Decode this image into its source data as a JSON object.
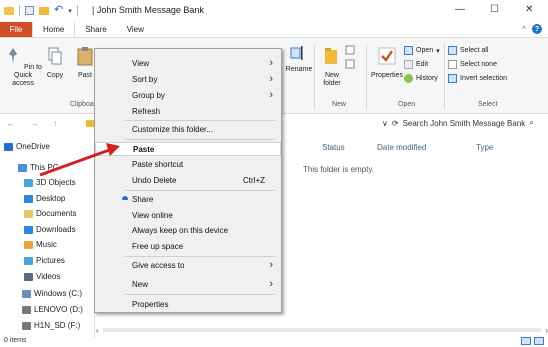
{
  "window": {
    "title": "John Smith Message Bank",
    "title_separator": "|",
    "minimize": "—",
    "maximize": "☐",
    "close": "✕"
  },
  "ribbon_tabs": {
    "file": "File",
    "home": "Home",
    "share": "Share",
    "view": "View"
  },
  "ribbon": {
    "pin_to_quick_access": "Pin to Quick access",
    "copy": "Copy",
    "paste_partial": "Past",
    "clipboard_group_partial": "Clipboa",
    "rename": "Rename",
    "new_folder": "New folder",
    "new_group": "New",
    "properties": "Properties",
    "open": "Open",
    "edit": "Edit",
    "history": "History",
    "open_group": "Open",
    "select_all": "Select all",
    "select_none": "Select none",
    "invert_selection": "Invert selection",
    "select_group": "Select"
  },
  "address_bar": {
    "nav": "← → ↑",
    "refresh": "⟳",
    "chevron": "∨",
    "search_placeholder": "Search John Smith Message Bank"
  },
  "nav_pane": {
    "items": [
      {
        "label": "OneDrive",
        "color": "#1e73c8"
      },
      {
        "label": "This PC",
        "color": "#4a90d9"
      },
      {
        "label": "3D Objects",
        "color": "#4aa3df"
      },
      {
        "label": "Desktop",
        "color": "#2e86de"
      },
      {
        "label": "Documents",
        "color": "#e8c468"
      },
      {
        "label": "Downloads",
        "color": "#2e86de"
      },
      {
        "label": "Music",
        "color": "#e8a33c"
      },
      {
        "label": "Pictures",
        "color": "#4aa3df"
      },
      {
        "label": "Videos",
        "color": "#5a6b7b"
      },
      {
        "label": "Windows (C:)",
        "color": "#6b8fbd"
      },
      {
        "label": "LENOVO (D:)",
        "color": "#777777"
      },
      {
        "label": "H1N_SD (F:)",
        "color": "#777777"
      }
    ]
  },
  "columns": {
    "status": "Status",
    "date_modified": "Date modified",
    "type": "Type"
  },
  "empty_message": "This folder is empty.",
  "status_bar": {
    "items": "0 items"
  },
  "context_menu": {
    "items": [
      {
        "label": "View",
        "submenu": true
      },
      {
        "label": "Sort by",
        "submenu": true
      },
      {
        "label": "Group by",
        "submenu": true
      },
      {
        "label": "Refresh"
      },
      {
        "label": "Customize this folder..."
      },
      {
        "label": "Paste",
        "highlighted": true
      },
      {
        "label": "Paste shortcut"
      },
      {
        "label": "Undo Delete",
        "shortcut": "Ctrl+Z"
      },
      {
        "label": "Share"
      },
      {
        "label": "View online"
      },
      {
        "label": "Always keep on this device"
      },
      {
        "label": "Free up space"
      },
      {
        "label": "Give access to",
        "submenu": true
      },
      {
        "label": "New",
        "submenu": true
      },
      {
        "label": "Properties"
      }
    ],
    "arrow_glyph": "›"
  },
  "colors": {
    "file_tab": "#d14f24",
    "accent": "#1e73c8",
    "annotation_arrow": "#d61f1f"
  }
}
